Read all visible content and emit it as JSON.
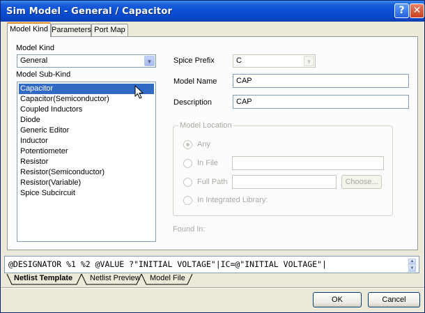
{
  "window": {
    "title": "Sim Model - General / Capacitor"
  },
  "tabs": [
    {
      "label": "Model Kind",
      "active": true
    },
    {
      "label": "Parameters",
      "active": false
    },
    {
      "label": "Port Map",
      "active": false
    }
  ],
  "model_kind": {
    "label": "Model Kind",
    "value": "General"
  },
  "model_sub_kind": {
    "label": "Model Sub-Kind",
    "items": [
      "Capacitor",
      "Capacitor(Semiconductor)",
      "Coupled Inductors",
      "Diode",
      "Generic Editor",
      "Inductor",
      "Potentiometer",
      "Resistor",
      "Resistor(Semiconductor)",
      "Resistor(Variable)",
      "Spice Subcircuit"
    ],
    "selected": "Capacitor"
  },
  "spice_prefix": {
    "label": "Spice Prefix",
    "value": "C"
  },
  "model_name": {
    "label": "Model Name",
    "value": "CAP"
  },
  "description": {
    "label": "Description",
    "value": "CAP"
  },
  "model_location": {
    "title": "Model Location",
    "any_label": "Any",
    "in_file_label": "In File",
    "full_path_label": "Full Path",
    "choose_label": "Choose...",
    "integrated_label": "In Integrated Library:"
  },
  "found_in": {
    "label": "Found In:"
  },
  "netlist_template": {
    "value": "@DESIGNATOR %1 %2 @VALUE ?\"INITIAL VOLTAGE\"|IC=@\"INITIAL VOLTAGE\"|"
  },
  "bottom_tabs": [
    {
      "label": "Netlist Template",
      "active": true
    },
    {
      "label": "Netlist Preview",
      "active": false
    },
    {
      "label": "Model File",
      "active": false
    }
  ],
  "buttons": {
    "ok": "OK",
    "cancel": "Cancel"
  }
}
